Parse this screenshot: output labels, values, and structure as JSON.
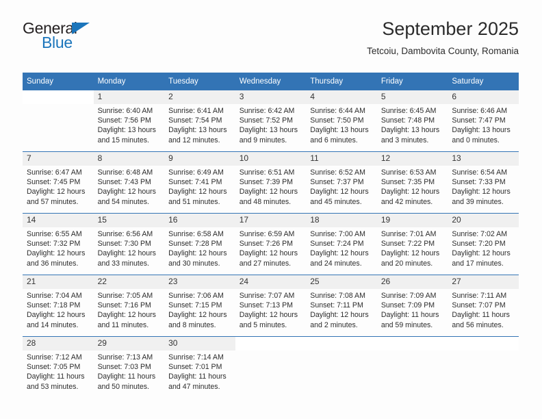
{
  "brand": {
    "name_part1": "General",
    "name_part2": "Blue"
  },
  "header": {
    "title": "September 2025",
    "subtitle": "Tetcoiu, Dambovita County, Romania"
  },
  "calendar": {
    "weekday_headers": [
      "Sunday",
      "Monday",
      "Tuesday",
      "Wednesday",
      "Thursday",
      "Friday",
      "Saturday"
    ],
    "colors": {
      "header_bg": "#3374b5",
      "daynum_bg": "#f0f0f0",
      "accent": "#1b75bb",
      "text": "#2c2c2c"
    },
    "weeks": [
      [
        {
          "day": "",
          "sunrise": "",
          "sunset": "",
          "daylight_line1": "",
          "daylight_line2": ""
        },
        {
          "day": "1",
          "sunrise": "Sunrise: 6:40 AM",
          "sunset": "Sunset: 7:56 PM",
          "daylight_line1": "Daylight: 13 hours",
          "daylight_line2": "and 15 minutes."
        },
        {
          "day": "2",
          "sunrise": "Sunrise: 6:41 AM",
          "sunset": "Sunset: 7:54 PM",
          "daylight_line1": "Daylight: 13 hours",
          "daylight_line2": "and 12 minutes."
        },
        {
          "day": "3",
          "sunrise": "Sunrise: 6:42 AM",
          "sunset": "Sunset: 7:52 PM",
          "daylight_line1": "Daylight: 13 hours",
          "daylight_line2": "and 9 minutes."
        },
        {
          "day": "4",
          "sunrise": "Sunrise: 6:44 AM",
          "sunset": "Sunset: 7:50 PM",
          "daylight_line1": "Daylight: 13 hours",
          "daylight_line2": "and 6 minutes."
        },
        {
          "day": "5",
          "sunrise": "Sunrise: 6:45 AM",
          "sunset": "Sunset: 7:48 PM",
          "daylight_line1": "Daylight: 13 hours",
          "daylight_line2": "and 3 minutes."
        },
        {
          "day": "6",
          "sunrise": "Sunrise: 6:46 AM",
          "sunset": "Sunset: 7:47 PM",
          "daylight_line1": "Daylight: 13 hours",
          "daylight_line2": "and 0 minutes."
        }
      ],
      [
        {
          "day": "7",
          "sunrise": "Sunrise: 6:47 AM",
          "sunset": "Sunset: 7:45 PM",
          "daylight_line1": "Daylight: 12 hours",
          "daylight_line2": "and 57 minutes."
        },
        {
          "day": "8",
          "sunrise": "Sunrise: 6:48 AM",
          "sunset": "Sunset: 7:43 PM",
          "daylight_line1": "Daylight: 12 hours",
          "daylight_line2": "and 54 minutes."
        },
        {
          "day": "9",
          "sunrise": "Sunrise: 6:49 AM",
          "sunset": "Sunset: 7:41 PM",
          "daylight_line1": "Daylight: 12 hours",
          "daylight_line2": "and 51 minutes."
        },
        {
          "day": "10",
          "sunrise": "Sunrise: 6:51 AM",
          "sunset": "Sunset: 7:39 PM",
          "daylight_line1": "Daylight: 12 hours",
          "daylight_line2": "and 48 minutes."
        },
        {
          "day": "11",
          "sunrise": "Sunrise: 6:52 AM",
          "sunset": "Sunset: 7:37 PM",
          "daylight_line1": "Daylight: 12 hours",
          "daylight_line2": "and 45 minutes."
        },
        {
          "day": "12",
          "sunrise": "Sunrise: 6:53 AM",
          "sunset": "Sunset: 7:35 PM",
          "daylight_line1": "Daylight: 12 hours",
          "daylight_line2": "and 42 minutes."
        },
        {
          "day": "13",
          "sunrise": "Sunrise: 6:54 AM",
          "sunset": "Sunset: 7:33 PM",
          "daylight_line1": "Daylight: 12 hours",
          "daylight_line2": "and 39 minutes."
        }
      ],
      [
        {
          "day": "14",
          "sunrise": "Sunrise: 6:55 AM",
          "sunset": "Sunset: 7:32 PM",
          "daylight_line1": "Daylight: 12 hours",
          "daylight_line2": "and 36 minutes."
        },
        {
          "day": "15",
          "sunrise": "Sunrise: 6:56 AM",
          "sunset": "Sunset: 7:30 PM",
          "daylight_line1": "Daylight: 12 hours",
          "daylight_line2": "and 33 minutes."
        },
        {
          "day": "16",
          "sunrise": "Sunrise: 6:58 AM",
          "sunset": "Sunset: 7:28 PM",
          "daylight_line1": "Daylight: 12 hours",
          "daylight_line2": "and 30 minutes."
        },
        {
          "day": "17",
          "sunrise": "Sunrise: 6:59 AM",
          "sunset": "Sunset: 7:26 PM",
          "daylight_line1": "Daylight: 12 hours",
          "daylight_line2": "and 27 minutes."
        },
        {
          "day": "18",
          "sunrise": "Sunrise: 7:00 AM",
          "sunset": "Sunset: 7:24 PM",
          "daylight_line1": "Daylight: 12 hours",
          "daylight_line2": "and 24 minutes."
        },
        {
          "day": "19",
          "sunrise": "Sunrise: 7:01 AM",
          "sunset": "Sunset: 7:22 PM",
          "daylight_line1": "Daylight: 12 hours",
          "daylight_line2": "and 20 minutes."
        },
        {
          "day": "20",
          "sunrise": "Sunrise: 7:02 AM",
          "sunset": "Sunset: 7:20 PM",
          "daylight_line1": "Daylight: 12 hours",
          "daylight_line2": "and 17 minutes."
        }
      ],
      [
        {
          "day": "21",
          "sunrise": "Sunrise: 7:04 AM",
          "sunset": "Sunset: 7:18 PM",
          "daylight_line1": "Daylight: 12 hours",
          "daylight_line2": "and 14 minutes."
        },
        {
          "day": "22",
          "sunrise": "Sunrise: 7:05 AM",
          "sunset": "Sunset: 7:16 PM",
          "daylight_line1": "Daylight: 12 hours",
          "daylight_line2": "and 11 minutes."
        },
        {
          "day": "23",
          "sunrise": "Sunrise: 7:06 AM",
          "sunset": "Sunset: 7:15 PM",
          "daylight_line1": "Daylight: 12 hours",
          "daylight_line2": "and 8 minutes."
        },
        {
          "day": "24",
          "sunrise": "Sunrise: 7:07 AM",
          "sunset": "Sunset: 7:13 PM",
          "daylight_line1": "Daylight: 12 hours",
          "daylight_line2": "and 5 minutes."
        },
        {
          "day": "25",
          "sunrise": "Sunrise: 7:08 AM",
          "sunset": "Sunset: 7:11 PM",
          "daylight_line1": "Daylight: 12 hours",
          "daylight_line2": "and 2 minutes."
        },
        {
          "day": "26",
          "sunrise": "Sunrise: 7:09 AM",
          "sunset": "Sunset: 7:09 PM",
          "daylight_line1": "Daylight: 11 hours",
          "daylight_line2": "and 59 minutes."
        },
        {
          "day": "27",
          "sunrise": "Sunrise: 7:11 AM",
          "sunset": "Sunset: 7:07 PM",
          "daylight_line1": "Daylight: 11 hours",
          "daylight_line2": "and 56 minutes."
        }
      ],
      [
        {
          "day": "28",
          "sunrise": "Sunrise: 7:12 AM",
          "sunset": "Sunset: 7:05 PM",
          "daylight_line1": "Daylight: 11 hours",
          "daylight_line2": "and 53 minutes."
        },
        {
          "day": "29",
          "sunrise": "Sunrise: 7:13 AM",
          "sunset": "Sunset: 7:03 PM",
          "daylight_line1": "Daylight: 11 hours",
          "daylight_line2": "and 50 minutes."
        },
        {
          "day": "30",
          "sunrise": "Sunrise: 7:14 AM",
          "sunset": "Sunset: 7:01 PM",
          "daylight_line1": "Daylight: 11 hours",
          "daylight_line2": "and 47 minutes."
        },
        {
          "day": "",
          "sunrise": "",
          "sunset": "",
          "daylight_line1": "",
          "daylight_line2": ""
        },
        {
          "day": "",
          "sunrise": "",
          "sunset": "",
          "daylight_line1": "",
          "daylight_line2": ""
        },
        {
          "day": "",
          "sunrise": "",
          "sunset": "",
          "daylight_line1": "",
          "daylight_line2": ""
        },
        {
          "day": "",
          "sunrise": "",
          "sunset": "",
          "daylight_line1": "",
          "daylight_line2": ""
        }
      ]
    ]
  }
}
